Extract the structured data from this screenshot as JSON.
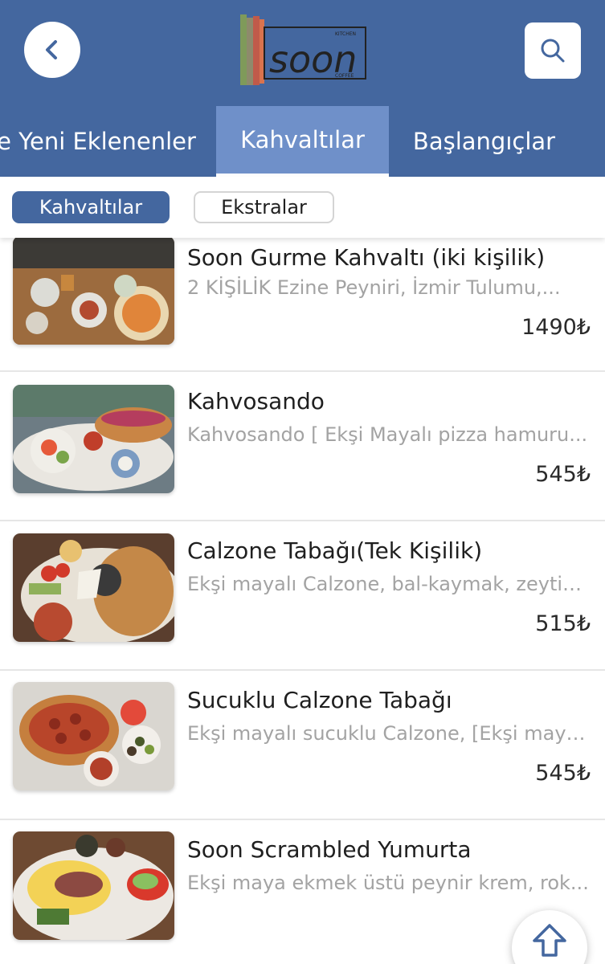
{
  "header": {
    "back_icon": "chevron-left-icon",
    "search_icon": "search-icon",
    "logo": {
      "main": "soon",
      "top_small": "KITCHEN",
      "bottom_small": "COFFEE"
    }
  },
  "tabs": [
    {
      "label": "e Yeni Eklenenler",
      "active": false
    },
    {
      "label": "Kahvaltılar",
      "active": true
    },
    {
      "label": "Başlangıçlar",
      "active": false
    }
  ],
  "subtabs": [
    {
      "label": "Kahvaltılar",
      "active": true
    },
    {
      "label": "Ekstralar",
      "active": false
    }
  ],
  "items": [
    {
      "title": "Soon Gurme Kahvaltı (iki kişilik)",
      "description": "2 KİŞİLİK Ezine Peyniri, İzmir Tulumu,...",
      "price": "1490₺"
    },
    {
      "title": "Kahvosando",
      "description": "Kahvosando [ Ekşi Mayalı pizza hamuru...",
      "price": "545₺"
    },
    {
      "title": "Calzone Tabağı(Tek Kişilik)",
      "description": "Ekşi mayalı Calzone, bal-kaymak, zeytin...",
      "price": "515₺"
    },
    {
      "title": "Sucuklu Calzone Tabağı",
      "description": "Ekşi mayalı sucuklu Calzone, [Ekşi maya...",
      "price": "545₺"
    },
    {
      "title": "Soon Scrambled Yumurta",
      "description": "Ekşi maya ekmek üstü peynir krem, rok...",
      "price": ""
    }
  ],
  "scroll_top_icon": "arrow-up-icon",
  "colors": {
    "primary": "#44679f",
    "active_tab": "#6f90c9",
    "muted_text": "#a3a3a3"
  }
}
